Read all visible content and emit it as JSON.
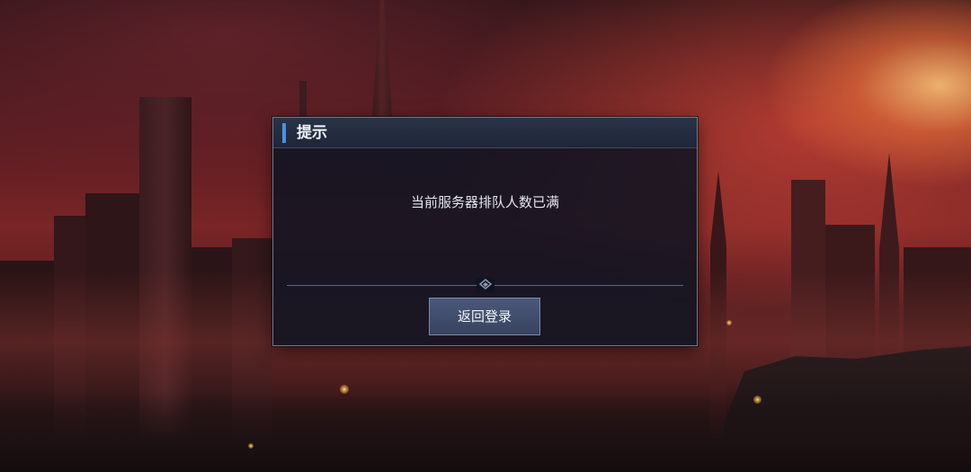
{
  "dialog": {
    "title": "提示",
    "message": "当前服务器排队人数已满",
    "button_label": "返回登录",
    "accent_color": "#4e8fe0"
  }
}
